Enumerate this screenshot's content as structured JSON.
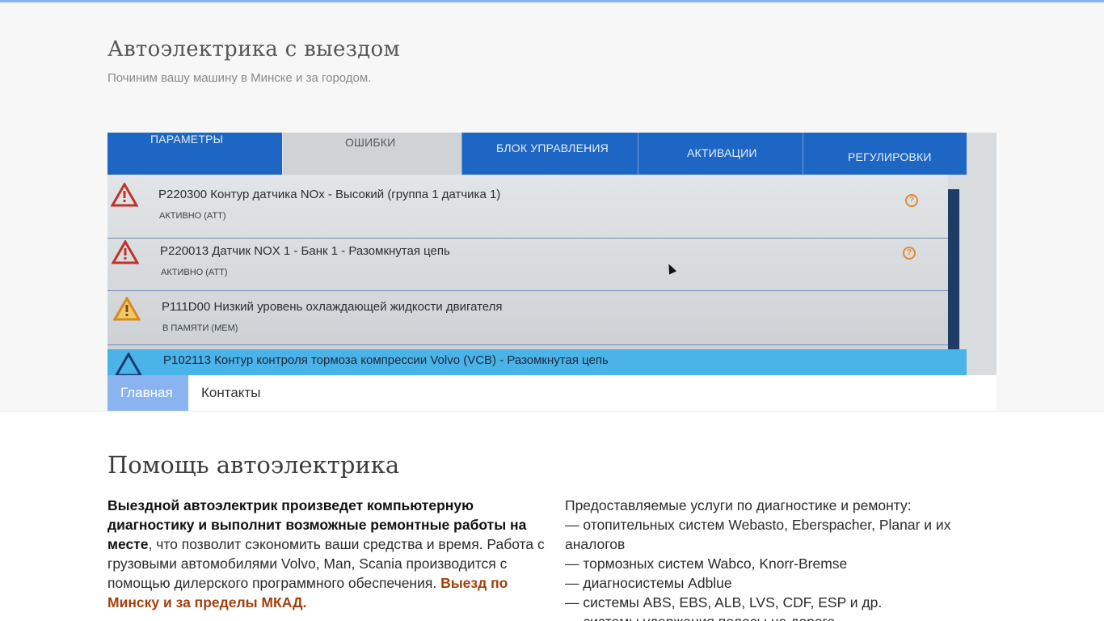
{
  "site": {
    "title": "Автоэлектрика с выездом",
    "description": "Починим вашу машину в Минске и за городом."
  },
  "banner": {
    "tabs": [
      "ПАРАМЕТРЫ",
      "ОШИБКИ",
      "БЛОК УПРАВЛЕНИЯ",
      "АКТИВАЦИИ",
      "РЕГУЛИРОВКИ"
    ],
    "errors": [
      {
        "title": "P220300 Контур датчика NOx - Высокий (группа 1 датчика 1)",
        "status": "АКТИВНО (ATT)"
      },
      {
        "title": "P220013 Датчик NOX 1 - Банк 1 - Разомкнутая цепь",
        "status": "АКТИВНО (ATT)"
      },
      {
        "title": "P111D00 Низкий уровень охлаждающей жидкости двигателя",
        "status": "В ПАМЯТИ (MEM)"
      },
      {
        "title": "P102113 Контур контроля тормоза компрессии Volvo (VCB) - Разомкнутая цепь",
        "status": ""
      }
    ],
    "colors": {
      "tab_blue": "#1e66c4",
      "highlight": "#4ab3e8",
      "warn_red": "#c0312b",
      "warn_orange": "#e08a30"
    }
  },
  "nav": {
    "items": [
      {
        "label": "Главная",
        "active": true
      },
      {
        "label": "Контакты",
        "active": false
      }
    ],
    "accent": "#8ab4f0"
  },
  "main": {
    "title": "Помощь автоэлектрика",
    "left": {
      "bold_intro": "Выездной автоэлектрик произведет компьютерную диагностику и выполнит возможные ремонтные работы на месте",
      "text1": ", что позволит сэкономить ваши средства и время. Работа с грузовыми автомобилями Volvo, Man, Scania производится с помощью дилерского программного обеспечения. ",
      "link": "Выезд по Минску и за пределы МКАД."
    },
    "right": {
      "heading": "Предоставляемые услуги по диагностике и ремонту:",
      "items": [
        "— отопительных систем Webasto, Eberspacher, Planar и их аналогов",
        "— тормозных систем Wabco, Knorr-Bremse",
        "— диагносистемы Adblue",
        "— системы ABS, EBS, ALB, LVS, CDF, ESP и др.",
        "— системы удержания полосы на дороге"
      ]
    }
  }
}
